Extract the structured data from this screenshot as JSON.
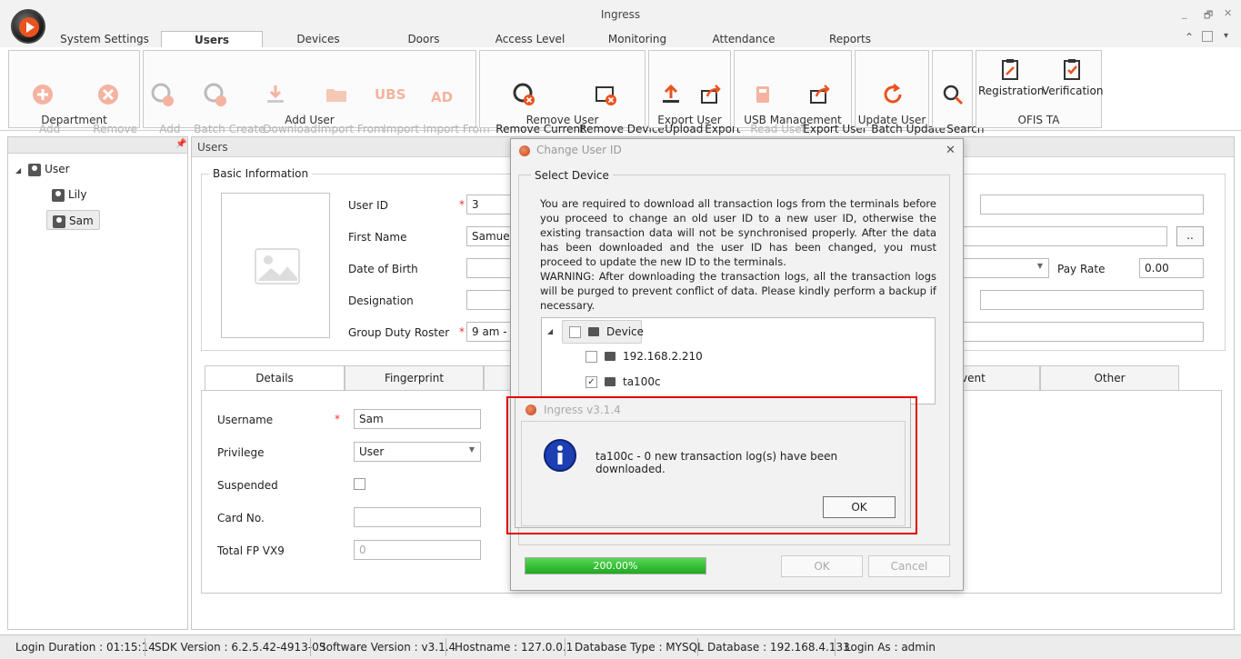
{
  "window": {
    "title": "Ingress",
    "min": "_",
    "restore": "🗗",
    "close": "✕"
  },
  "ribbon_tabs": [
    {
      "label": "System Settings"
    },
    {
      "label": "Users"
    },
    {
      "label": "Devices"
    },
    {
      "label": "Doors"
    },
    {
      "label": "Access Level"
    },
    {
      "label": "Monitoring"
    },
    {
      "label": "Attendance"
    },
    {
      "label": "Reports"
    }
  ],
  "ribbon_right": {
    "collapse": "⌃",
    "options": "▾"
  },
  "groups": {
    "department": {
      "title": "Department",
      "add": "Add\nDepartment",
      "remove": "Remove\nDepartment"
    },
    "add_user": {
      "title": "Add User",
      "add": "Add\nUser",
      "batch": "Batch Create\nUser",
      "download": "Download\nUser",
      "import_file": "Import From\nFile",
      "import_ubs": "Import\nUBS",
      "import_ad": "Import From\nAD"
    },
    "remove_user": {
      "title": "Remove User",
      "remove_current": "Remove Current\nUser",
      "remove_device": "Remove Device\nUser"
    },
    "export_user": {
      "title": "Export User",
      "upload": "Upload\nUser",
      "export": "Export\nUser"
    },
    "usb": {
      "title": "USB Management",
      "read": "Read User\nfrom USB",
      "export": "Export User\nto USB"
    },
    "update_user": {
      "title": "Update User",
      "batch_update": "Batch Update\nUser"
    },
    "search": {
      "label": "Search\nUser"
    },
    "ofis": {
      "title": "OFIS TA",
      "registration": "Registration",
      "verification": "Verification"
    }
  },
  "icon_text": {
    "ubs": "UBS",
    "ad": "AD"
  },
  "tree": {
    "root": "User",
    "children": [
      "Lily",
      "Sam"
    ],
    "expand": "◢"
  },
  "main": {
    "panel_title": "Users",
    "basic_info": "Basic Information",
    "labels": {
      "user_id": "User ID",
      "first_name": "First Name",
      "dob": "Date of Birth",
      "designation": "Designation",
      "roster": "Group Duty Roster",
      "pay_rate": "Pay Rate"
    },
    "values": {
      "user_id": "3",
      "first_name": "Samuel",
      "roster": "9 am - 5",
      "pay_rate": "0.00",
      "browse": ".."
    },
    "required": "*",
    "tabs": [
      "Details",
      "Fingerprint",
      "vent",
      "Other"
    ],
    "details": {
      "username_label": "Username",
      "username": "Sam",
      "privilege_label": "Privilege",
      "privilege": "User",
      "suspended_label": "Suspended",
      "card_label": "Card No.",
      "fp_label": "Total FP VX9",
      "fp_value": "0"
    }
  },
  "dialog": {
    "title": "Change User ID",
    "group": "Select Device",
    "message": "You are required to download all transaction logs from the terminals before you proceed to change an old user ID to a new user ID, otherwise the existing transaction data will not be synchronised properly. After the data has been downloaded and the user ID has been changed, you must proceed to update the new ID to the terminals.",
    "warning": "WARNING: After downloading the transaction logs, all the transaction logs will be purged to prevent conflict of data. Please kindly perform a backup if necessary.",
    "tree_root": "Device",
    "devices": [
      "192.168.2.210",
      "ta100c"
    ],
    "progress_text": "200.00%",
    "progress": 1.0,
    "ok": "OK",
    "cancel": "Cancel",
    "close": "✕"
  },
  "msgbox": {
    "title": "Ingress v3.1.4",
    "message": "ta100c - 0 new transaction log(s) have been downloaded.",
    "ok": "OK"
  },
  "status": [
    "Login Duration : 01:15:14",
    "SDK Version : 6.2.5.42-4913-03",
    "Software Version : v3.1.4",
    "Hostname : 127.0.0.1",
    "Database Type : MYSQL",
    "Database : 192.168.4.133",
    "Login As : admin"
  ],
  "colors": {
    "accent_orange": "#e8531f",
    "progress_green": "#2fbf2f",
    "highlight_red": "#e00000"
  }
}
